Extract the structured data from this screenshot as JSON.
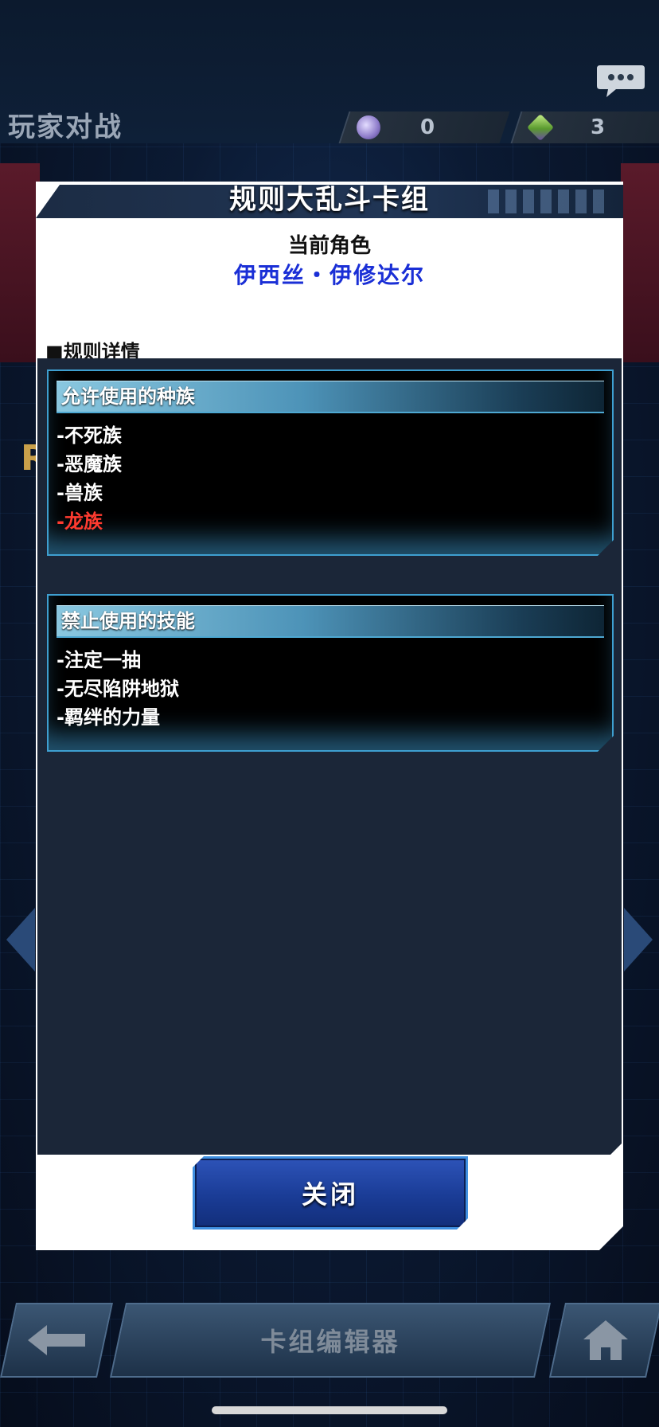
{
  "background": {
    "mode_title": "玩家对战",
    "currencies": [
      {
        "name": "orb-currency",
        "value": "0",
        "color": "#9b8ad6"
      },
      {
        "name": "gem-currency",
        "value": "3",
        "color": "#7fb84a"
      }
    ],
    "bottom_nav": {
      "back_icon": "arrow-left-icon",
      "center_label": "卡组编辑器",
      "home_icon": "home-icon"
    }
  },
  "modal": {
    "title": "规则大乱斗卡组",
    "character_label": "当前角色",
    "character_name": "伊西丝・伊修达尔",
    "section_title": "■规则详情",
    "allowed": {
      "heading": "允许使用的种族",
      "items": [
        {
          "text": "-不死族",
          "highlight": false
        },
        {
          "text": "-恶魔族",
          "highlight": false
        },
        {
          "text": "-兽族",
          "highlight": false
        },
        {
          "text": "-龙族",
          "highlight": true
        }
      ]
    },
    "banned": {
      "heading": "禁止使用的技能",
      "items": [
        {
          "text": "-注定一抽"
        },
        {
          "text": "-无尽陷阱地狱"
        },
        {
          "text": "-羁绊的力量"
        }
      ]
    },
    "close_label": "关闭"
  },
  "colors": {
    "character_name": "#1a2fd6",
    "highlight_text": "#ff3b30",
    "accent_border": "#3e9fd0",
    "close_button": "#1a3c96"
  }
}
